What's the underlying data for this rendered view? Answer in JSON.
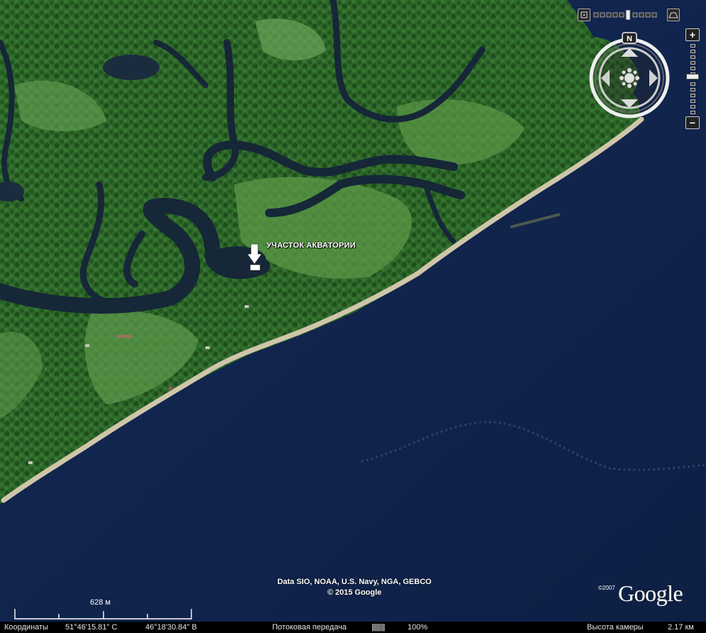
{
  "placemark": {
    "label": "УЧАСТОК АКВАТОРИИ"
  },
  "attribution": {
    "line1": "Data SIO, NOAA, U.S. Navy, NGA, GEBCO",
    "line2": "© 2015 Google"
  },
  "logo": {
    "year": "©2007",
    "text": "Google"
  },
  "scale": {
    "label": "628 м"
  },
  "status": {
    "coords_label": "Координаты",
    "lat": "51°46'15.81\" С",
    "lon": "46°18'30.84\" В",
    "stream_label": "Потоковая передача",
    "stream_bars": "||||||||||",
    "stream_pct": "100%",
    "alt_label": "Высота камеры",
    "alt_value": "2.17 км"
  },
  "compass": {
    "north": "N"
  },
  "zoom": {
    "plus": "+",
    "minus": "−"
  },
  "colors": {
    "water": "#10224a",
    "land": "#2f6b2c",
    "meadow": "#5f9a4a",
    "river": "#16283a",
    "beach": "#cdc3a5"
  }
}
